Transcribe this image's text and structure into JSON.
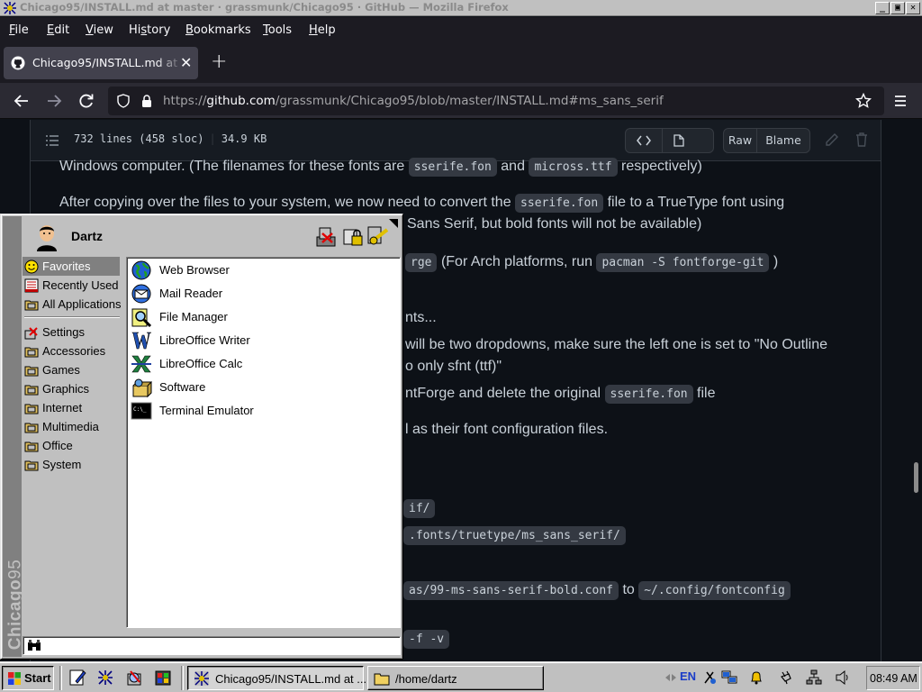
{
  "window": {
    "title": "Chicago95/INSTALL.md at master · grassmunk/Chicago95 · GitHub — Mozilla Firefox",
    "minimize": "_",
    "maximize": "▣",
    "close": "✕"
  },
  "menubar": {
    "items": [
      {
        "pre": "",
        "u": "F",
        "post": "ile"
      },
      {
        "pre": "",
        "u": "E",
        "post": "dit"
      },
      {
        "pre": "",
        "u": "V",
        "post": "iew"
      },
      {
        "pre": "Hi",
        "u": "s",
        "post": "tory"
      },
      {
        "pre": "",
        "u": "B",
        "post": "ookmarks"
      },
      {
        "pre": "",
        "u": "T",
        "post": "ools"
      },
      {
        "pre": "",
        "u": "H",
        "post": "elp"
      }
    ]
  },
  "tab": {
    "title": "Chicago95/INSTALL.md at master · grassmunk/Chicago95",
    "close": "✕",
    "new_tab": "+"
  },
  "navbar": {
    "url_prefix": "https://",
    "url_host": "github.com",
    "url_path": "/grassmunk/Chicago95/blob/master/INSTALL.md#ms_sans_serif"
  },
  "file_header": {
    "lines": "732 lines (458 sloc)",
    "size": "34.9 KB",
    "raw": "Raw",
    "blame": "Blame"
  },
  "content": {
    "l1a": "Windows computer. (The filenames for these fonts are",
    "l1c1": "sserife.fon",
    "l1b": "and",
    "l1c2": "micross.ttf",
    "l1d": "respectively)",
    "l2a": "After copying over the files to your system, we now need to convert the",
    "l2c": "sserife.fon",
    "l2b": "file to a TrueType font using",
    "l3": "Sans Serif, but bold fonts will not be available)",
    "l4c1": "rge",
    "l4a": "(For Arch platforms, run",
    "l4c2": "pacman -S fontforge-git",
    "l4b": ")",
    "l5": "nts...",
    "l6": "will be two dropdowns, make sure the left one is set to \"No Outline",
    "l7": "o only sfnt (ttf)\"",
    "l8a": "ntForge and delete the original",
    "l8c": "sserife.fon",
    "l8b": "file",
    "l9": "l as their font configuration files.",
    "c1": "if/",
    "c2": ".fonts/truetype/ms_sans_serif/",
    "c3": "as/99-ms-sans-serif-bold.conf",
    "l10": "to",
    "c4": "~/.config/fontconfig",
    "c5": "-f -v"
  },
  "start_menu": {
    "brand_bold": "Chicago",
    "brand_rest": "95",
    "username": "Dartz",
    "categories_top": [
      "Favorites",
      "Recently Used",
      "All Applications"
    ],
    "categories": [
      "Settings",
      "Accessories",
      "Games",
      "Graphics",
      "Internet",
      "Multimedia",
      "Office",
      "System"
    ],
    "apps": [
      "Web Browser",
      "Mail Reader",
      "File Manager",
      "LibreOffice Writer",
      "LibreOffice Calc",
      "Software",
      "Terminal Emulator"
    ],
    "search_value": ""
  },
  "taskbar": {
    "start": "Start",
    "tasks": [
      "Chicago95/INSTALL.md at ...",
      "/home/dartz"
    ],
    "lang": "EN",
    "clock": "08:49 AM"
  },
  "colors": {
    "github_bg": "#0d1117",
    "win95_face": "#c0c0c0",
    "selection": "#808080"
  }
}
